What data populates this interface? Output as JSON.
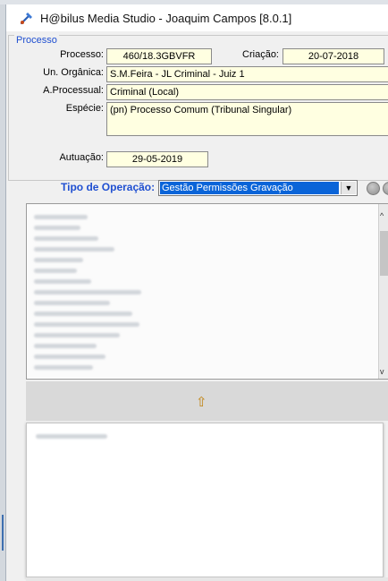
{
  "window": {
    "title": "H@bilus Media Studio -  Joaquim Campos [8.0.1]",
    "app_icon": "tool-icon"
  },
  "processo": {
    "legend": "Processo",
    "processo_label": "Processo:",
    "processo_value": "460/18.3GBVFR",
    "criacao_label": "Criação:",
    "criacao_value": "20-07-2018",
    "un_organica_label": "Un. Orgânica:",
    "un_organica_value": "S.M.Feira - JL Criminal - Juiz 1",
    "a_processual_label": "A.Processual:",
    "a_processual_value": "Criminal (Local)",
    "especie_label": "Espécie:",
    "especie_value": "(pn) Processo Comum (Tribunal Singular)",
    "autuacao_label": "Autuação:",
    "autuacao_value": "29-05-2019"
  },
  "operacao": {
    "label": "Tipo de Operação:",
    "selected": "Gestão Permissões Gravação"
  },
  "colors": {
    "accent_blue": "#1f4fd1",
    "field_bg": "#ffffe1",
    "selection": "#0a64d8"
  },
  "icons": {
    "move_up": "move-up-icon"
  }
}
